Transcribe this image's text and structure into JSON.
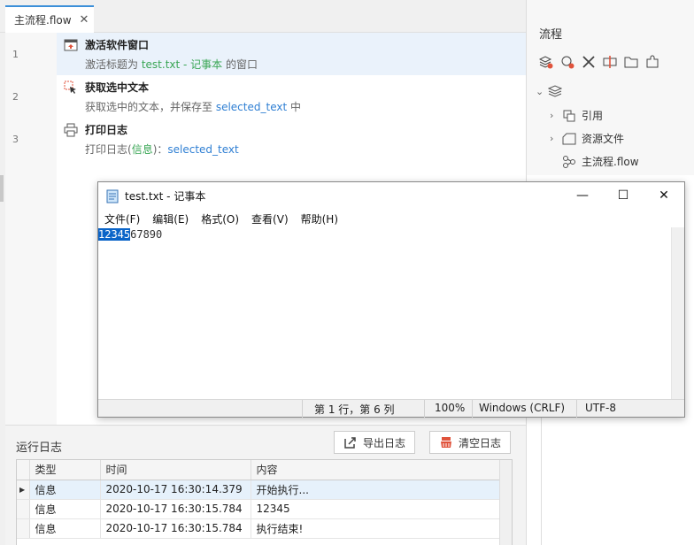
{
  "editor_tab": {
    "label": "主流程.flow",
    "close": "✕"
  },
  "steps": [
    {
      "line": "1",
      "title": "激活软件窗口",
      "desc_prefix": "激活标题为 ",
      "desc_highlight": "test.txt - 记事本",
      "desc_suffix": " 的窗口",
      "icon": "window-activate-icon"
    },
    {
      "line": "2",
      "title": "获取选中文本",
      "desc_prefix": "获取选中的文本，并保存至 ",
      "desc_highlight": "selected_text",
      "desc_suffix": " 中",
      "icon": "select-cursor-icon"
    },
    {
      "line": "3",
      "title": "打印日志",
      "desc_prefix": "打印日志(",
      "desc_green": "信息",
      "desc_mid": ")：",
      "desc_highlight": "selected_text",
      "icon": "printer-icon"
    }
  ],
  "log": {
    "title": "运行日志",
    "export_label": "导出日志",
    "clear_label": "清空日志",
    "columns": [
      "类型",
      "时间",
      "内容"
    ],
    "rows": [
      {
        "type": "信息",
        "time": "2020-10-17 16:30:14.379",
        "content": "开始执行..."
      },
      {
        "type": "信息",
        "time": "2020-10-17 16:30:15.784",
        "content": "12345"
      },
      {
        "type": "信息",
        "time": "2020-10-17 16:30:15.784",
        "content": "执行结束!"
      }
    ]
  },
  "right_panel": {
    "title": "流程",
    "tree": {
      "items": [
        {
          "label": "引用",
          "icon": "reference-icon"
        },
        {
          "label": "资源文件",
          "icon": "resource-file-icon"
        },
        {
          "label": "主流程.flow",
          "icon": "flow-file-icon"
        }
      ]
    }
  },
  "notepad": {
    "title": "test.txt - 记事本",
    "menu": [
      "文件(F)",
      "编辑(E)",
      "格式(O)",
      "查看(V)",
      "帮助(H)"
    ],
    "content_selected": "12345",
    "content_rest": "67890",
    "status": {
      "position": "第 1 行，第 6 列",
      "zoom": "100%",
      "line_ending": "Windows (CRLF)",
      "encoding": "UTF-8"
    }
  },
  "colors": {
    "accent": "#3b8fd8",
    "green": "#3aa655",
    "link": "#2f7fd3",
    "selection": "#0a64c8"
  }
}
